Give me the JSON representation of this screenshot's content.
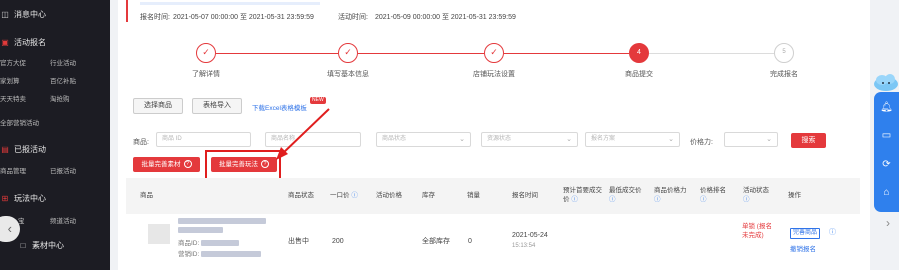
{
  "sidebar": {
    "sections": [
      {
        "icon": "message-icon",
        "title": "消息中心"
      },
      {
        "icon": "activity-icon",
        "title": "活动报名",
        "pairs": [
          [
            "官方大促",
            "行业活动"
          ],
          [
            "家划算",
            "百亿补贴"
          ],
          [
            "天天特卖",
            "淘抢购"
          ]
        ],
        "single": "全部营销活动"
      },
      {
        "icon": "registered-icon",
        "title": "已报活动",
        "pairs": [
          [
            "商品管理",
            "已报活动"
          ]
        ]
      },
      {
        "icon": "playbook-icon",
        "title": "玩法中心",
        "pairs": [
          [
            "宝",
            "频道活动"
          ]
        ]
      },
      {
        "icon": "material-icon",
        "title": "素材中心"
      }
    ]
  },
  "notice": {
    "reg_label": "报名时间:",
    "reg_value": "2021-05-07 00:00:00 至 2021-05-31 23:59:59",
    "act_label": "活动时间:",
    "act_value": "2021-05-09 00:00:00 至 2021-05-31 23:59:59"
  },
  "steps": [
    {
      "label": "了解详情",
      "state": "done",
      "mark": "✓"
    },
    {
      "label": "填写基本信息",
      "state": "done",
      "mark": "✓"
    },
    {
      "label": "店铺玩法设置",
      "state": "done",
      "mark": "✓"
    },
    {
      "label": "商品提交",
      "state": "current",
      "mark": "4"
    },
    {
      "label": "完成报名",
      "state": "todo",
      "mark": "5"
    }
  ],
  "toolbar": {
    "select_goods": "选择商品",
    "form_import": "表格导入",
    "download_template": "下载Excel表格模板",
    "new_badge": "NEW"
  },
  "filters": {
    "goods_label": "商品:",
    "goods_id_placeholder": "商品 ID",
    "goods_name_placeholder": "商品名称",
    "goods_status": "商品状态",
    "resource_status": "资源状态",
    "reg_plan": "报名方案",
    "price_power_label": "价格力:",
    "search": "搜索"
  },
  "batch": {
    "improve_material": "批量完善素材",
    "improve_play": "批量完善玩法"
  },
  "table": {
    "headers": [
      "商品",
      "商品状态",
      "一口价",
      "活动价格",
      "库存",
      "销量",
      "报名时间",
      "预计首要成交价",
      "最低成交价",
      "商品价格力",
      "价格排名",
      "活动状态",
      "操作"
    ],
    "row": {
      "id_label": "商品ID:",
      "marketing_id_label": "营销ID:",
      "status": "出售中",
      "price": "200",
      "stock": "全部库存",
      "sales": "0",
      "reg_date": "2021-05-24",
      "reg_time": "15:13:54",
      "activity_status": "单锁 (报名未完成)",
      "action_improve": "完善商品",
      "action_remove": "撤销报名"
    }
  },
  "colors": {
    "accent": "#e4393c",
    "link": "#2f73e8",
    "sidebar": "#1c1c23",
    "right_tab": "#2f80ed"
  }
}
